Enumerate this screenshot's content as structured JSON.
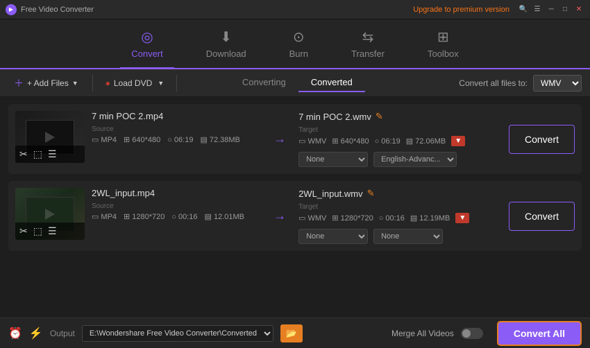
{
  "app": {
    "title": "Free Video Converter",
    "upgrade_label": "Upgrade to premium version"
  },
  "nav": {
    "items": [
      {
        "id": "convert",
        "label": "Convert",
        "icon": "⬤",
        "active": true
      },
      {
        "id": "download",
        "label": "Download",
        "icon": "⬇",
        "active": false
      },
      {
        "id": "burn",
        "label": "Burn",
        "icon": "⊙",
        "active": false
      },
      {
        "id": "transfer",
        "label": "Transfer",
        "icon": "⇆",
        "active": false
      },
      {
        "id": "toolbox",
        "label": "Toolbox",
        "icon": "☰",
        "active": false
      }
    ]
  },
  "toolbar": {
    "add_files_label": "+ Add Files",
    "load_dvd_label": "Load DVD",
    "converting_tab": "Converting",
    "converted_tab": "Converted",
    "convert_all_files_label": "Convert all files to:",
    "format_value": "WMV"
  },
  "files": [
    {
      "id": "file1",
      "source_name": "7 min POC 2.mp4",
      "target_name": "7 min POC 2.wmv",
      "source": {
        "format": "MP4",
        "resolution": "640*480",
        "duration": "06:19",
        "size": "72.38MB"
      },
      "target": {
        "format": "WMV",
        "resolution": "640*480",
        "duration": "06:19",
        "size": "72.06MB"
      },
      "subtitle": "None",
      "audio": "English-Advanc...",
      "convert_label": "Convert"
    },
    {
      "id": "file2",
      "source_name": "2WL_input.mp4",
      "target_name": "2WL_input.wmv",
      "source": {
        "format": "MP4",
        "resolution": "1280*720",
        "duration": "00:16",
        "size": "12.01MB"
      },
      "target": {
        "format": "WMV",
        "resolution": "1280*720",
        "duration": "00:16",
        "size": "12.19MB"
      },
      "subtitle": "None",
      "audio": "None",
      "convert_label": "Convert"
    }
  ],
  "bottom": {
    "output_label": "Output",
    "output_path": "E:\\Wondershare Free Video Converter\\Converted",
    "merge_label": "Merge All Videos",
    "convert_all_label": "Convert All"
  }
}
